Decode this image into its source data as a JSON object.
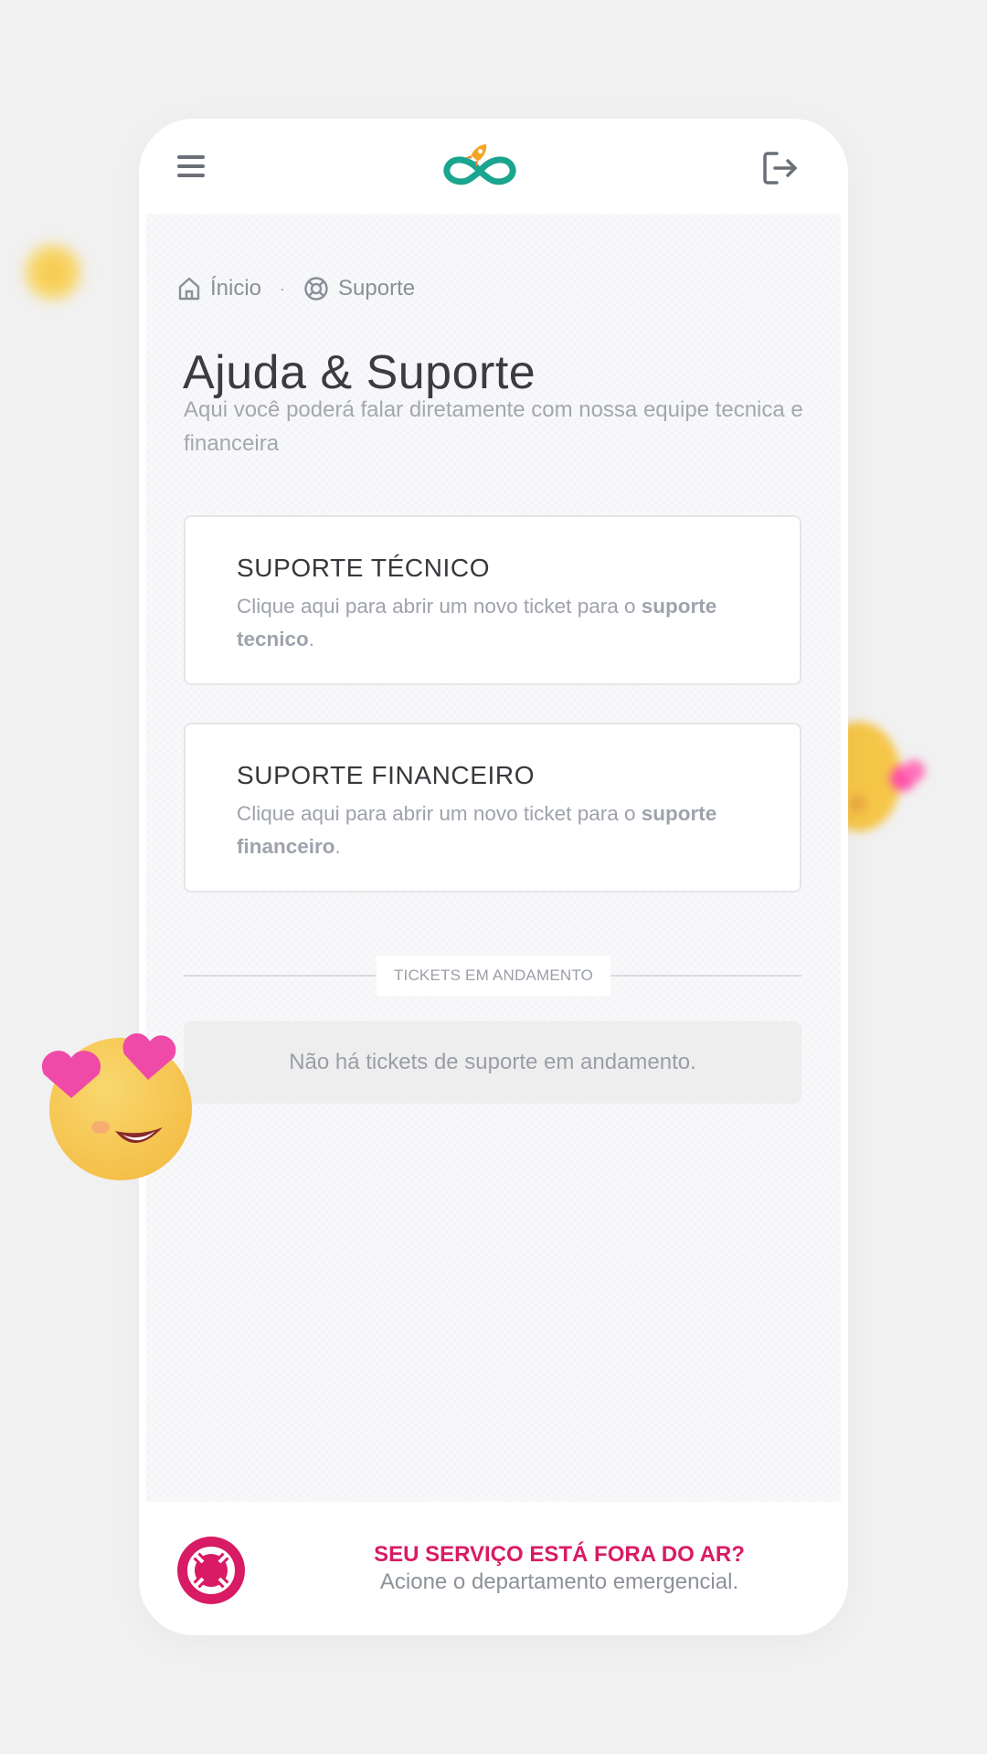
{
  "header": {
    "menu_icon": "hamburger-menu-icon",
    "logo_icon": "infinity-rocket-logo",
    "logout_icon": "logout-icon",
    "brand_color": "#1aa58f",
    "rocket_color": "#f5a623"
  },
  "breadcrumb": {
    "home_label": "Ínicio",
    "separator": "·",
    "current_label": "Suporte",
    "home_icon": "home-icon",
    "current_icon": "lifebuoy-icon"
  },
  "page": {
    "title": "Ajuda & Suporte",
    "subtitle": "Aqui você poderá falar diretamente com nossa equipe tecnica e financeira"
  },
  "cards": [
    {
      "title": "SUPORTE TÉCNICO",
      "desc_prefix": "Clique aqui para abrir um novo ticket para o ",
      "desc_bold": "suporte tecnico",
      "desc_suffix": "."
    },
    {
      "title": "SUPORTE FINANCEIRO",
      "desc_prefix": "Clique aqui para abrir um novo ticket para o ",
      "desc_bold": "suporte financeiro",
      "desc_suffix": "."
    }
  ],
  "tickets": {
    "section_label": "TICKETS EM ANDAMENTO",
    "empty_message": "Não há tickets de suporte em andamento."
  },
  "footer": {
    "title": "SEU SERVIÇO ESTÁ FORA DO AR?",
    "subtitle": "Acione o departamento emergencial.",
    "icon": "lifebuoy-icon",
    "accent_color": "#d81b64"
  }
}
